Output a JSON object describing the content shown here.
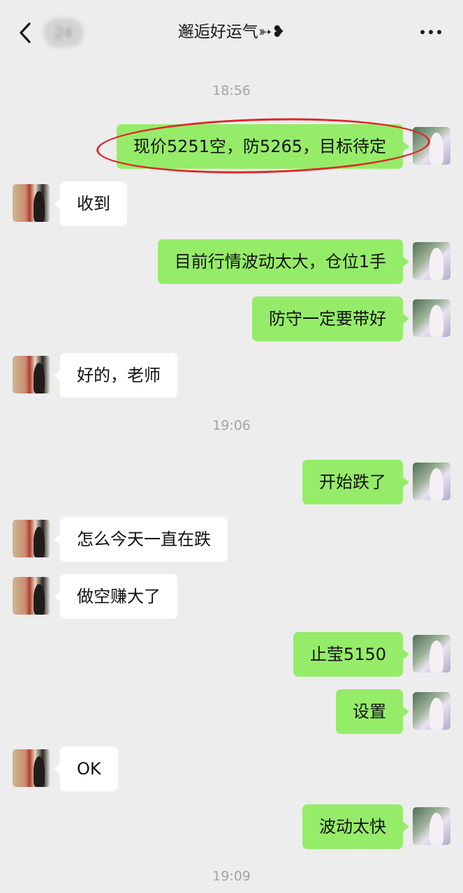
{
  "header": {
    "title": "邂逅好运气➳❥",
    "unread_count": "24",
    "back_icon": "chevron-left-icon",
    "more_icon": "more-dots-icon"
  },
  "timestamps": [
    "18:56",
    "19:06",
    "19:09"
  ],
  "messages": [
    {
      "side": "me",
      "text": "现价5251空，防5265，目标待定"
    },
    {
      "side": "them",
      "text": "收到"
    },
    {
      "side": "me",
      "text": "目前行情波动太大，仓位1手"
    },
    {
      "side": "me",
      "text": "防守一定要带好"
    },
    {
      "side": "them",
      "text": "好的，老师"
    },
    {
      "side": "me",
      "text": "开始跌了"
    },
    {
      "side": "them",
      "text": "怎么今天一直在跌"
    },
    {
      "side": "them",
      "text": "做空赚大了"
    },
    {
      "side": "me",
      "text": "止莹5150"
    },
    {
      "side": "me",
      "text": "设置"
    },
    {
      "side": "them",
      "text": "OK"
    },
    {
      "side": "me",
      "text": "波动太快"
    }
  ],
  "colors": {
    "background": "#ededed",
    "my_bubble": "#95ec69",
    "their_bubble": "#ffffff",
    "annotation_circle": "#e0262a"
  }
}
